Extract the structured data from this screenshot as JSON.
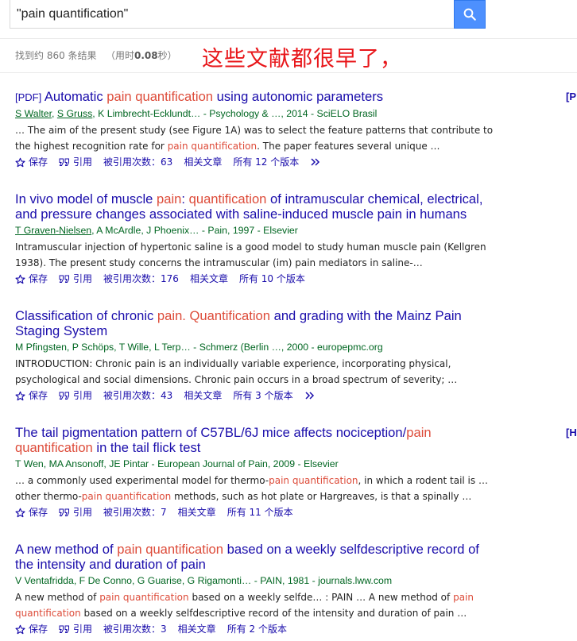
{
  "search": {
    "query": "\"pain quantification\""
  },
  "stats": {
    "prefix": "找到约 860 条结果",
    "time_prefix": "（用时",
    "time": "0.08",
    "time_suffix": "秒）"
  },
  "annotation": "这些文献都很早了，",
  "results": [
    {
      "tag": "[PDF]",
      "title": [
        [
          "t",
          "Automatic "
        ],
        [
          "h",
          "pain quantification"
        ],
        [
          "t",
          " using autonomic parameters"
        ]
      ],
      "authors": [
        [
          "u",
          "S Walter"
        ],
        [
          "t",
          ", "
        ],
        [
          "u",
          "S Gruss"
        ],
        [
          "t",
          ", K Limbrecht-Ecklundt… - Psychology & …, 2014 - SciELO Brasil"
        ]
      ],
      "snippet": [
        [
          "t",
          "… The aim of the present study (see Figure 1A) was to select the feature patterns that contribute to the highest recognition rate for "
        ],
        [
          "h",
          "pain quantification"
        ],
        [
          "t",
          ". The paper features several unique …"
        ]
      ],
      "actions": {
        "save": "保存",
        "cite": "引用",
        "cited_by": "被引用次数：63",
        "related": "相关文章",
        "versions": "所有 12 个版本"
      },
      "side_tag": "[P"
    },
    {
      "tag": "",
      "title": [
        [
          "t",
          "In vivo model of muscle "
        ],
        [
          "h",
          "pain"
        ],
        [
          "t",
          ": "
        ],
        [
          "h",
          "quantification"
        ],
        [
          "t",
          " of intramuscular chemical, electrical, and pressure changes associated with saline-induced muscle pain in humans"
        ]
      ],
      "authors": [
        [
          "u",
          "T Graven-Nielsen"
        ],
        [
          "t",
          ", A McArdle, J Phoenix… - Pain, 1997 - Elsevier"
        ]
      ],
      "snippet": [
        [
          "t",
          "Intramuscular injection of hypertonic saline is a good model to study human muscle pain (Kellgren 1938). The present study concerns the intramuscular (im) pain mediators in saline-…"
        ]
      ],
      "actions": {
        "save": "保存",
        "cite": "引用",
        "cited_by": "被引用次数：176",
        "related": "相关文章",
        "versions": "所有 10 个版本"
      },
      "side_tag": ""
    },
    {
      "tag": "",
      "title": [
        [
          "t",
          "Classification of chronic "
        ],
        [
          "h",
          "pain. Quantification"
        ],
        [
          "t",
          " and grading with the Mainz Pain Staging System"
        ]
      ],
      "authors": [
        [
          "t",
          "M Pfingsten, P Schöps, T Wille, L Terp… - Schmerz (Berlin …, 2000 - europepmc.org"
        ]
      ],
      "snippet": [
        [
          "t",
          "INTRODUCTION: Chronic pain is an individually variable experience, incorporating physical, psychological and social dimensions. Chronic pain occurs in a broad spectrum of severity; …"
        ]
      ],
      "actions": {
        "save": "保存",
        "cite": "引用",
        "cited_by": "被引用次数：43",
        "related": "相关文章",
        "versions": "所有 3 个版本"
      },
      "side_tag": ""
    },
    {
      "tag": "",
      "title": [
        [
          "t",
          "The tail pigmentation pattern of C57BL/6J mice affects nociception/"
        ],
        [
          "h",
          "pain quantification"
        ],
        [
          "t",
          " in the tail flick test"
        ]
      ],
      "authors": [
        [
          "t",
          "T Wen, MA Ansonoff, JE Pintar - European Journal of Pain, 2009 - Elsevier"
        ]
      ],
      "snippet": [
        [
          "t",
          "… a commonly used experimental model for thermo-"
        ],
        [
          "h",
          "pain quantification"
        ],
        [
          "t",
          ", in which a rodent tail is … other thermo-"
        ],
        [
          "h",
          "pain quantification"
        ],
        [
          "t",
          " methods, such as hot plate or Hargreaves, is that a spinally …"
        ]
      ],
      "actions": {
        "save": "保存",
        "cite": "引用",
        "cited_by": "被引用次数：7",
        "related": "相关文章",
        "versions": "所有 11 个版本"
      },
      "side_tag": "[H"
    },
    {
      "tag": "",
      "title": [
        [
          "t",
          "A new method of "
        ],
        [
          "h",
          "pain quantification"
        ],
        [
          "t",
          " based on a weekly selfdescriptive record of the intensity and duration of pain"
        ]
      ],
      "authors": [
        [
          "t",
          "V Ventafridda, F De Conno, G Guarise, G Rigamonti… - PAIN, 1981 - journals.lww.com"
        ]
      ],
      "snippet": [
        [
          "t",
          "A new method of "
        ],
        [
          "h",
          "pain quantification"
        ],
        [
          "t",
          " based on a weekly selfde… : PAIN … A new method of "
        ],
        [
          "h",
          "pain quantification"
        ],
        [
          "t",
          " based on a weekly selfdescriptive record of the intensity and duration of pain …"
        ]
      ],
      "actions": {
        "save": "保存",
        "cite": "引用",
        "cited_by": "被引用次数：3",
        "related": "相关文章",
        "versions": "所有 2 个版本"
      },
      "side_tag": ""
    }
  ],
  "colors": {
    "link": "#1a0dab",
    "highlight": "#dd4b39",
    "authors": "#006621",
    "annotation": "#e8161a",
    "search_button": "#4d90fe"
  }
}
